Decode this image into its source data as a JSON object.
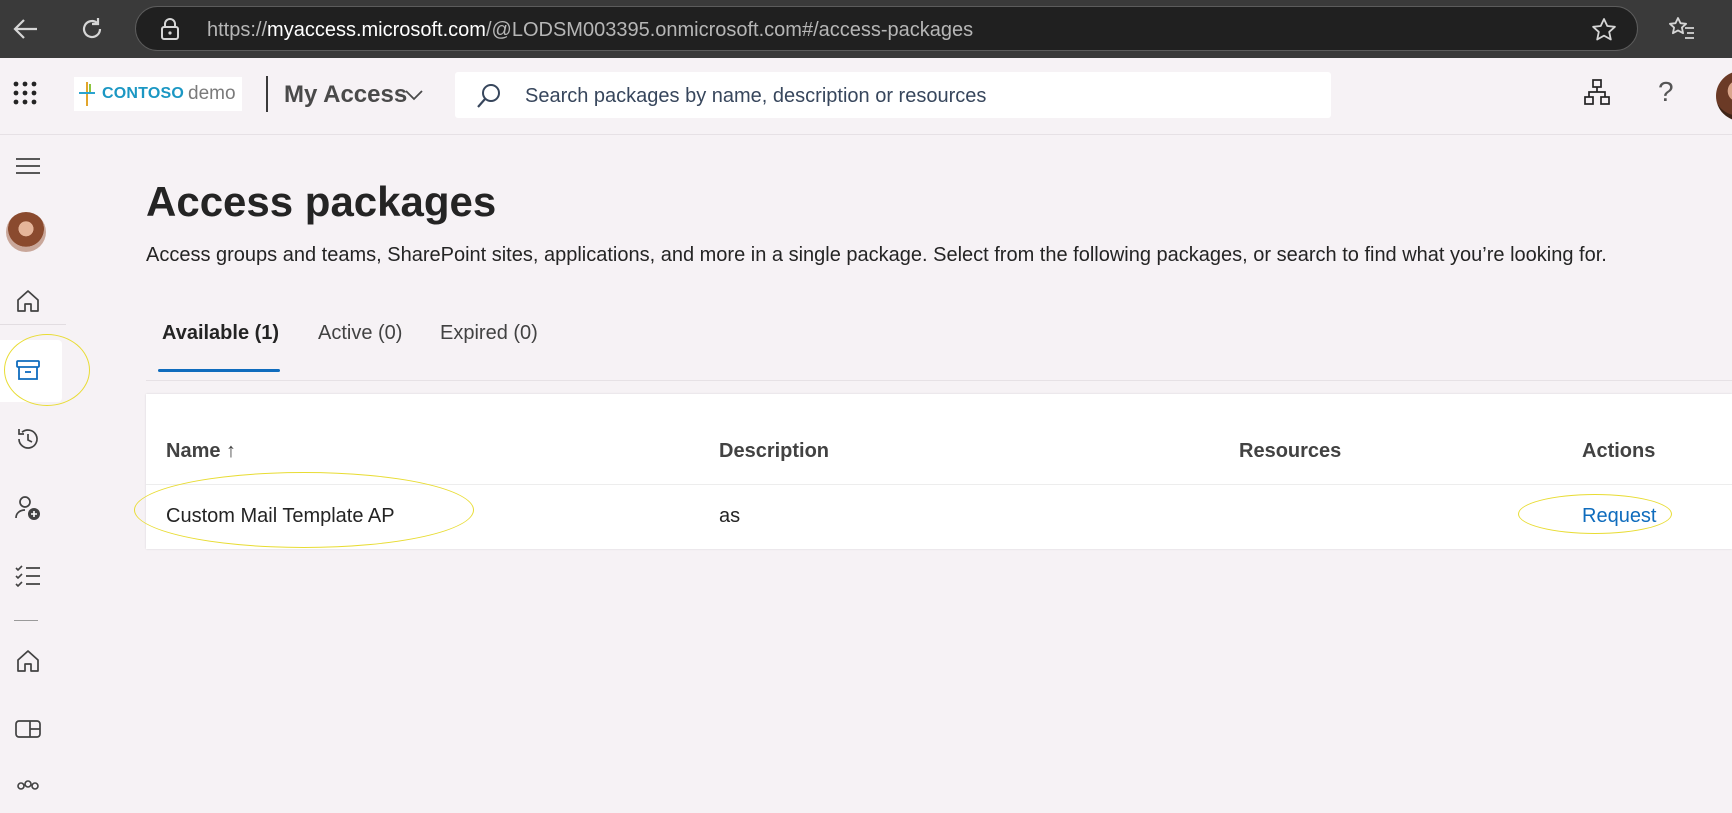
{
  "browser": {
    "url_prefix": "https://",
    "url_host": "myaccess.microsoft.com",
    "url_path": "/@LODSM003395.onmicrosoft.com#/access-packages",
    "icons": [
      "back-arrow-icon",
      "refresh-icon",
      "lock-icon",
      "star-icon",
      "favorites-icon"
    ]
  },
  "header": {
    "logo_brand": "CONTOSO",
    "logo_sub": "demo",
    "app_name": "My Access",
    "search_placeholder": "Search packages by name, description or resources",
    "icons": [
      "app-launcher-icon",
      "org-chart-icon",
      "help-icon",
      "user-avatar"
    ]
  },
  "rail": {
    "items": [
      "menu-icon",
      "profile-avatar",
      "home-icon",
      "access-packages-icon",
      "history-icon",
      "request-access-icon",
      "approvals-icon",
      "home-icon",
      "card-icon",
      "groups-icon"
    ],
    "selected": "access-packages-icon"
  },
  "page": {
    "title": "Access packages",
    "description": "Access groups and teams, SharePoint sites, applications, and more in a single package. Select from the following packages, or search to find what you’re looking for."
  },
  "tabs": [
    {
      "label": "Available (1)",
      "active": true
    },
    {
      "label": "Active (0)",
      "active": false
    },
    {
      "label": "Expired (0)",
      "active": false
    }
  ],
  "table": {
    "columns": [
      "Name ↑",
      "Description",
      "Resources",
      "Actions"
    ],
    "rows": [
      {
        "name": "Custom Mail Template AP",
        "description": "as",
        "resources": "",
        "action": "Request"
      }
    ]
  },
  "colors": {
    "accent": "#0f6cbd",
    "highlight": "#e8dc33",
    "background": "#f6f2f5"
  }
}
